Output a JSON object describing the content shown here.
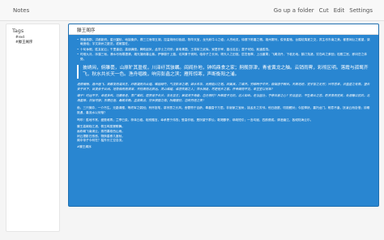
{
  "app": {
    "title": "Notes"
  },
  "nav": {
    "go_up": "Go up a folder",
    "cut": "Cut",
    "edit": "Edit",
    "settings": "Settings"
  },
  "sidebar": {
    "heading": "Tags",
    "items": [
      "#red",
      "#滕王阁序"
    ]
  },
  "note": {
    "title": "滕王阁序",
    "bullets": [
      "豫章故郡，洪都新府。星分翼轸，地接衡庐。襟三江而带五湖，控蛮荆而引瓯越。物华天宝，龙光射牛斗之墟；人杰地灵，徐孺下陈蕃之榻。雄州雾列，俊采星驰。台隍枕夷夏之交，宾主尽东南之美。都督阎公之雅望，棨戟遥临；宇文新州之懿范，襜帷暂驻。",
      "十旬休假，胜友如云；千里逢迎，高朋满座。腾蛟起凤，孟学士之词宗；紫电青霜，王将军之武库。家君作宰，路出名区；童子何知，躬逢胜饯。",
      "时维九月，序属三秋。潦水尽而寒潭清，烟光凝而暮山紫。俨骖騑于上路，访风景于崇阿。临帝子之长洲，得天人之旧馆。层峦耸翠，上出重霄；飞阁流丹，下临无地。鹤汀凫渚，穷岛屿之萦回；桂殿兰宫，即冈峦之体势。"
    ],
    "quote": "披绣闼，俯雕甍，山原旷其盈视，川泽纡其骇瞩。闾阎扑地，钟鸣鼎食之家；舸舰弥津，青雀黄龙之舳。云销雨霁，彩彻区明。落霞与孤鹜齐飞，秋水共长天一色。渔舟唱晚，响穷彭蠡之滨；雁阵惊寒，声断衡阳之浦。",
    "p1": "遥襟甫畅，逸兴遄飞。爽籁发而清风生，纤歌凝而白云遏。睢园绿竹，气凌彭泽之樽；邺水朱华，光照临川之笔。四美具，二难并。穷睇眄于中天，极娱游于暇日。天高地迥，觉宇宙之无穷；兴尽悲来，识盈虚之有数。望长安于日下，目吴会于云间。地势极而南溟深，天柱高而北辰远。关山难越，谁悲失路之人；萍水相逢，尽是他乡之客。怀帝阍而不见，奉宣室以何年？",
    "p2": "嗟乎！时运不齐，命途多舛。冯唐易老，李广难封。屈贾谊于长沙，非无圣主；窜梁鸿于海曲，岂乏明时？所赖君子见机，达人知命。老当益壮，宁移白首之心？穷且益坚，不坠青云之志。酌贪泉而觉爽，处涸辙以犹欢。北海虽赊，扶摇可接；东隅已逝，桑榆非晚。孟尝高洁，空余报国之情；阮籍猖狂，岂效穷途之哭！",
    "p3": "勃，三尺微命，一介书生。无路请缨，等终军之弱冠；有怀投笔，慕宗悫之长风。舍簪笏于百龄，奉晨昏于万里。非谢家之宝树，接孟氏之芳邻。他日趋庭，叨陪鲤对；今兹捧袂，喜托龙门。杨意不逢，抚凌云而自惜；钟期既遇，奏流水以何惭？",
    "p4": "呜呼！胜地不常，盛筵难再；兰亭已矣，梓泽丘墟。临别赠言，幸承恩于伟饯；登高作赋，是所望于群公。敢竭鄙怀，恭疏短引；一言均赋，四韵俱成。请洒潘江，各倾陆海云尔。",
    "poem": [
      "滕王高阁临江渚，佩玉鸣鸾罢歌舞。",
      "画栋朝飞南浦云，珠帘暮卷西山雨。",
      "闲云潭影日悠悠，物换星移几度秋。",
      "阁中帝子今何在？槛外长江空自流。"
    ],
    "tag": "#滕王阁序"
  }
}
